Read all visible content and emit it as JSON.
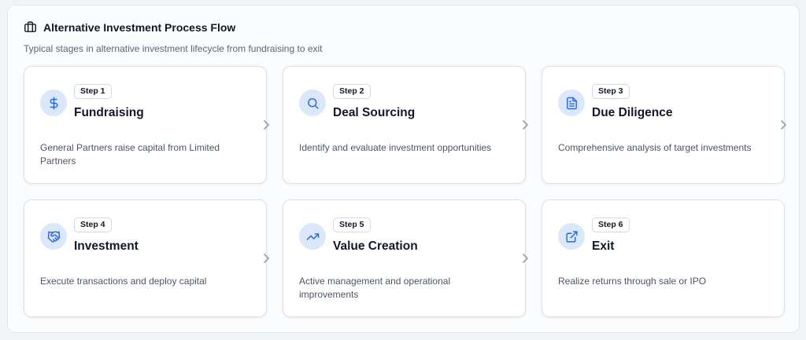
{
  "header": {
    "icon": "briefcase-icon",
    "title": "Alternative Investment Process Flow",
    "subtitle": "Typical stages in alternative investment lifecycle from fundraising to exit"
  },
  "colors": {
    "accent": "#2563eb",
    "icon_bg": "#dbe7fa",
    "title_text": "#111827",
    "body_text": "#4b5563",
    "chevron": "#9ca3af"
  },
  "steps": [
    {
      "badge": "Step 1",
      "title": "Fundraising",
      "description": "General Partners raise capital from Limited Partners",
      "icon": "dollar-sign-icon"
    },
    {
      "badge": "Step 2",
      "title": "Deal Sourcing",
      "description": "Identify and evaluate investment opportunities",
      "icon": "search-icon"
    },
    {
      "badge": "Step 3",
      "title": "Due Diligence",
      "description": "Comprehensive analysis of target investments",
      "icon": "document-icon"
    },
    {
      "badge": "Step 4",
      "title": "Investment",
      "description": "Execute transactions and deploy capital",
      "icon": "handshake-icon"
    },
    {
      "badge": "Step 5",
      "title": "Value Creation",
      "description": "Active management and operational improvements",
      "icon": "trending-up-icon"
    },
    {
      "badge": "Step 6",
      "title": "Exit",
      "description": "Realize returns through sale or IPO",
      "icon": "external-link-icon"
    }
  ]
}
